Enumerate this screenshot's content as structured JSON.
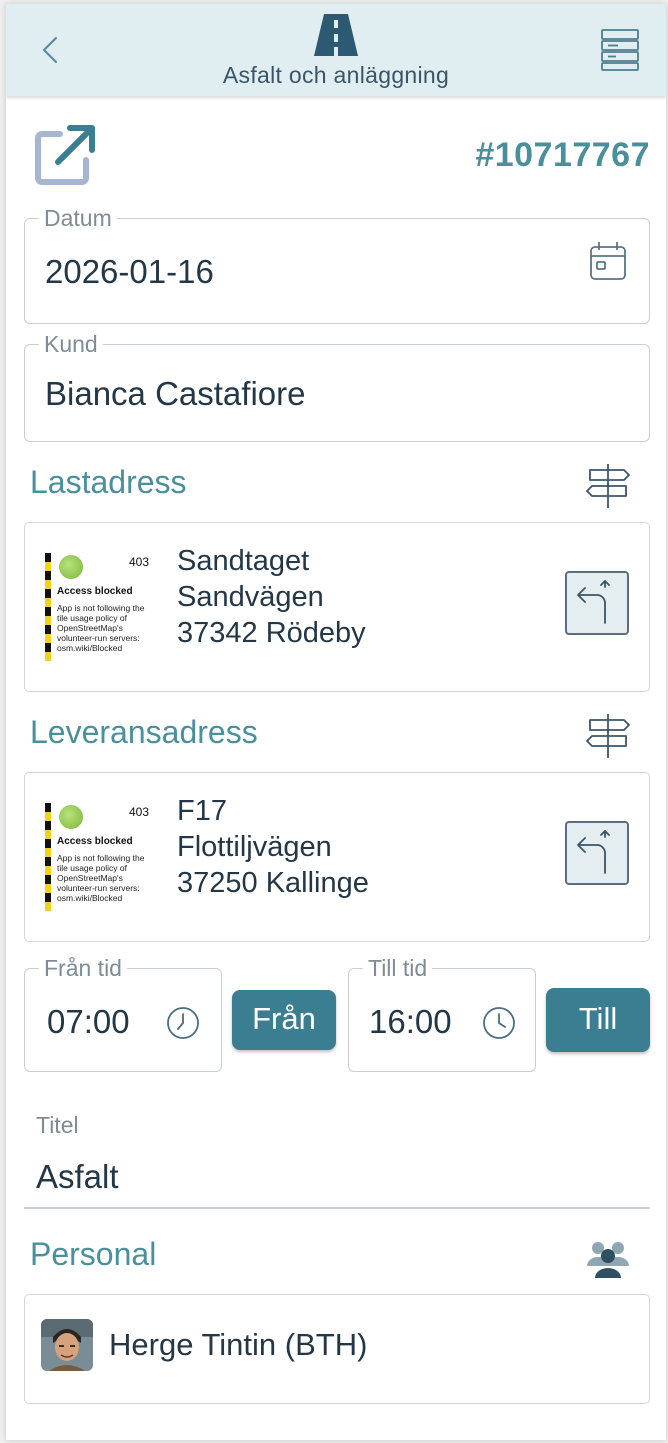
{
  "header": {
    "title": "Asfalt och anläggning",
    "back_icon": "chevron-left-icon",
    "logo_icon": "road-icon",
    "menu_icon": "list-icon"
  },
  "order": {
    "number": "#10717767",
    "open_icon": "external-link-icon"
  },
  "datum": {
    "label": "Datum",
    "value": "2026-01-16",
    "icon": "calendar-icon"
  },
  "kund": {
    "label": "Kund",
    "value": "Bianca Castafiore"
  },
  "lastadress": {
    "title": "Lastadress",
    "icon": "signpost-icon",
    "line1": "Sandtaget",
    "line2": "Sandvägen",
    "line3": "37342 Rödeby",
    "map": {
      "code": "403",
      "heading": "Access blocked",
      "text": "App is not following the tile usage policy of OpenStreetMap's volunteer-run servers: osm.wiki/Blocked"
    },
    "route_icon": "turn-left-icon"
  },
  "leveransadress": {
    "title": "Leveransadress",
    "icon": "signpost-icon",
    "line1": "F17",
    "line2": "Flottiljvägen",
    "line3": "37250 Kallinge",
    "map": {
      "code": "403",
      "heading": "Access blocked",
      "text": "App is not following the tile usage policy of OpenStreetMap's volunteer-run servers: osm.wiki/Blocked"
    },
    "route_icon": "turn-left-icon"
  },
  "time": {
    "from_label": "Från tid",
    "from_value": "07:00",
    "from_button": "Från",
    "to_label": "Till tid",
    "to_value": "16:00",
    "to_button": "Till"
  },
  "titel": {
    "label": "Titel",
    "value": "Asfalt"
  },
  "personal": {
    "title": "Personal",
    "icon": "people-icon",
    "members": [
      {
        "name": "Herge Tintin (BTH)"
      }
    ]
  },
  "colors": {
    "accent": "#4a8f9c",
    "button": "#3c7e91",
    "header_bg": "#e1eef1",
    "text": "#243746"
  }
}
